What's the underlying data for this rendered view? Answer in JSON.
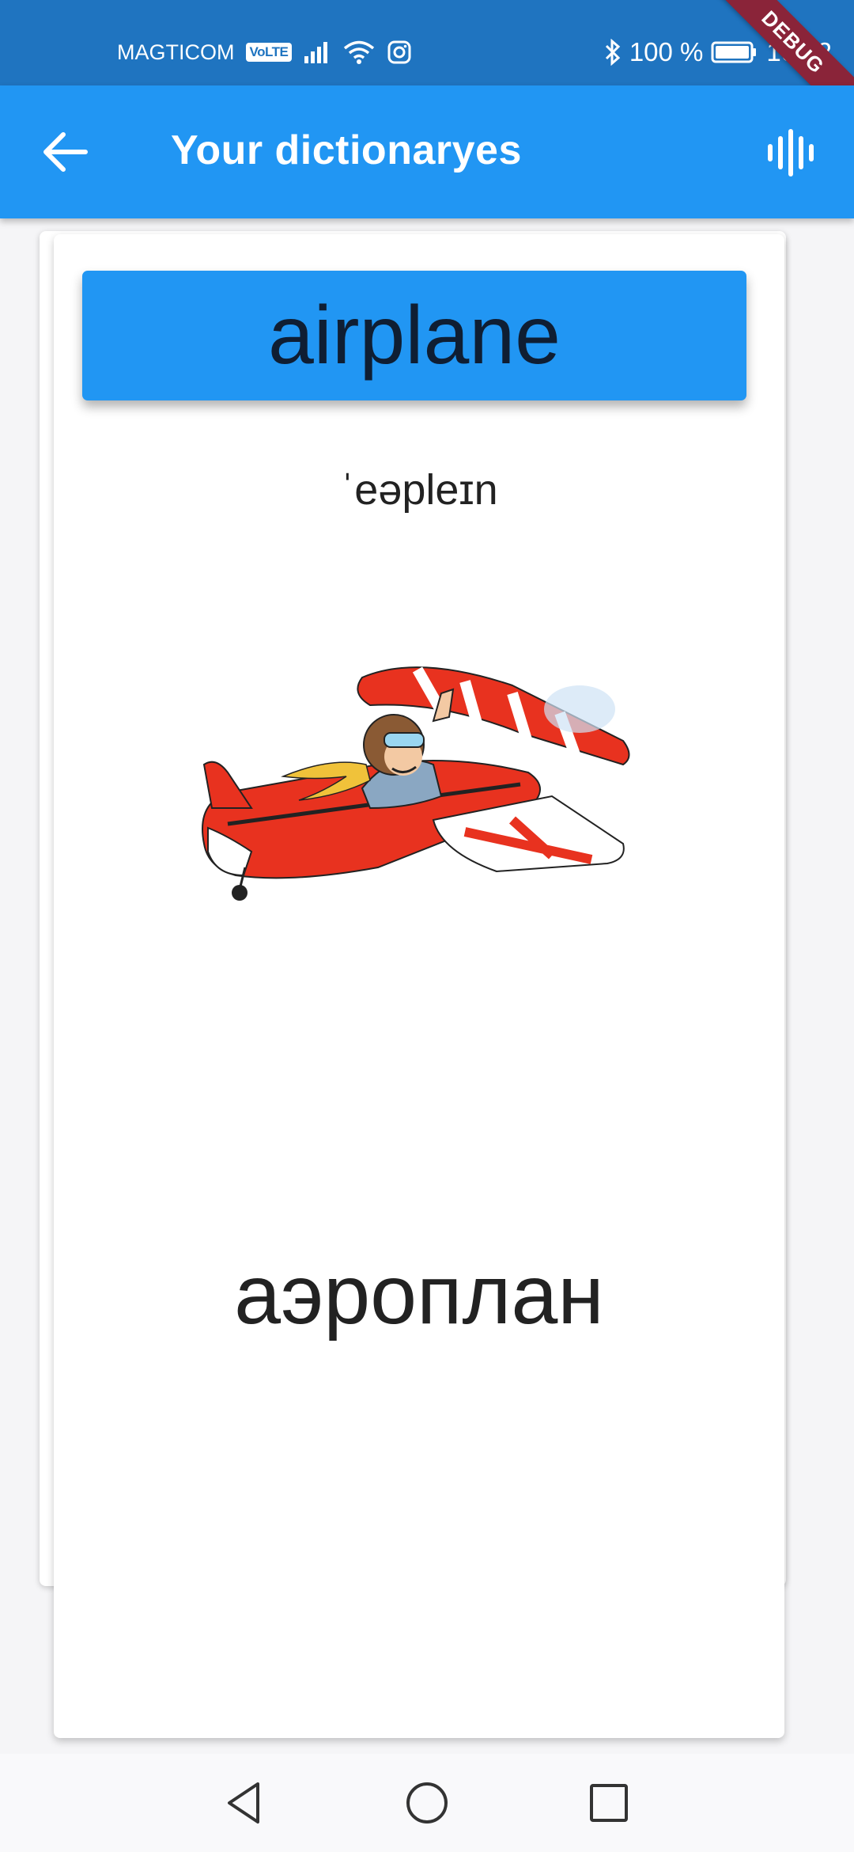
{
  "status_bar": {
    "carrier": "MAGTICOM",
    "volte_badge": "VoLTE",
    "battery_percent": "100 %",
    "time": "10:42",
    "icons": [
      "signal-icon",
      "wifi-icon",
      "instagram-icon",
      "bluetooth-icon",
      "battery-icon"
    ]
  },
  "debug_banner": "DEBUG",
  "app_bar": {
    "title": "Your dictionaryes",
    "back_icon": "arrow-back-icon",
    "voice_icon": "voice-wave-icon"
  },
  "card": {
    "word": "airplane",
    "transcription": "ˈeəpleɪn",
    "image": "airplane-illustration",
    "translation": "аэроплан"
  },
  "nav_bar": {
    "icons": [
      "back-triangle-icon",
      "home-circle-icon",
      "recents-square-icon"
    ]
  },
  "colors": {
    "status_bar": "#1f74c0",
    "app_bar": "#2196f3",
    "word_banner": "#2196f3",
    "debug_ribbon": "#8a2439"
  }
}
